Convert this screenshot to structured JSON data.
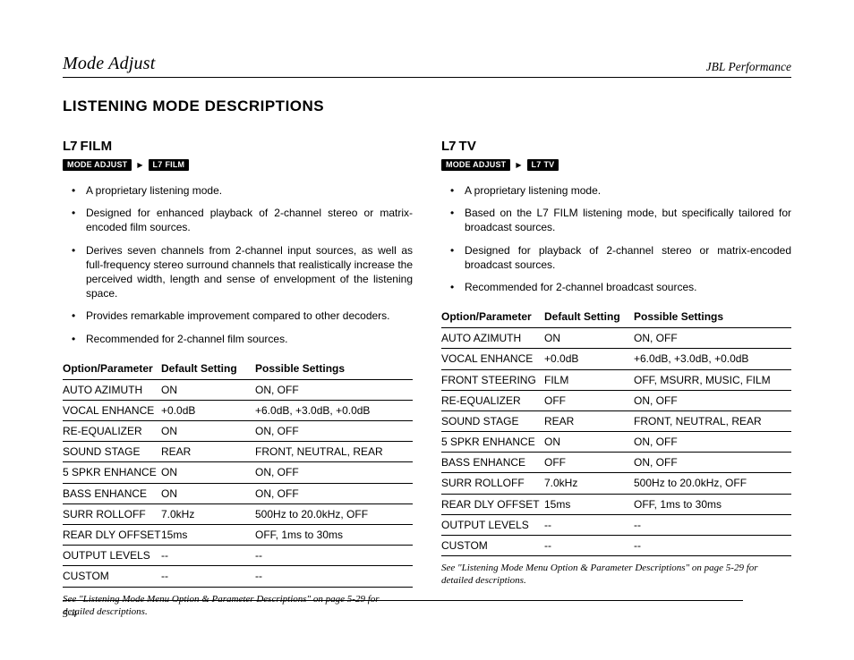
{
  "header": {
    "left": "Mode Adjust",
    "right": "JBL Performance"
  },
  "section_title": "LISTENING MODE DESCRIPTIONS",
  "page_number": "5-4",
  "caption": "See \"Listening Mode Menu Option & Parameter Descriptions\" on page 5-29 for detailed descriptions.",
  "table_headers": {
    "opt": "Option/Parameter",
    "def": "Default Setting",
    "pos": "Possible Settings"
  },
  "l7_prefix": "L7",
  "breadcrumb_mode_adjust": "MODE ADJUST",
  "left_mode": {
    "title": "FILM",
    "breadcrumb_target": "FILM",
    "bullets": [
      "A proprietary listening mode.",
      "Designed for enhanced playback of 2-channel stereo or matrix-encoded film sources.",
      "Derives seven channels from 2-channel input sources, as well as full-frequency stereo surround channels that realistically increase the perceived width, length and sense of envelopment of the listening space.",
      "Provides remarkable improvement compared to other decoders.",
      "Recommended for 2-channel film sources."
    ],
    "rows": [
      {
        "opt": "AUTO AZIMUTH",
        "def": "ON",
        "pos": "ON, OFF"
      },
      {
        "opt": "VOCAL ENHANCE",
        "def": "+0.0dB",
        "pos": "+6.0dB, +3.0dB, +0.0dB"
      },
      {
        "opt": "RE-EQUALIZER",
        "def": "ON",
        "pos": "ON, OFF"
      },
      {
        "opt": "SOUND STAGE",
        "def": "REAR",
        "pos": "FRONT, NEUTRAL, REAR"
      },
      {
        "opt": "5 SPKR ENHANCE",
        "def": "ON",
        "pos": "ON, OFF"
      },
      {
        "opt": "BASS ENHANCE",
        "def": "ON",
        "pos": "ON, OFF"
      },
      {
        "opt": "SURR ROLLOFF",
        "def": "7.0kHz",
        "pos": "500Hz to 20.0kHz, OFF"
      },
      {
        "opt": "REAR DLY OFFSET",
        "def": "15ms",
        "pos": "OFF, 1ms to 30ms"
      },
      {
        "opt": "OUTPUT LEVELS",
        "def": "--",
        "pos": "--"
      },
      {
        "opt": "CUSTOM",
        "def": "--",
        "pos": "--"
      }
    ]
  },
  "right_mode": {
    "title": "TV",
    "breadcrumb_target": "TV",
    "bullets": [
      "A proprietary listening mode.",
      "Based on the L7 FILM listening mode, but specifically tailored for broadcast sources.",
      "Designed for playback of 2-channel stereo or matrix-encoded broadcast sources.",
      "Recommended for 2-channel broadcast sources."
    ],
    "rows": [
      {
        "opt": "AUTO AZIMUTH",
        "def": "ON",
        "pos": "ON, OFF"
      },
      {
        "opt": "VOCAL ENHANCE",
        "def": "+0.0dB",
        "pos": "+6.0dB, +3.0dB, +0.0dB"
      },
      {
        "opt": "FRONT STEERING",
        "def": "FILM",
        "pos": "OFF, MSURR, MUSIC, FILM"
      },
      {
        "opt": "RE-EQUALIZER",
        "def": "OFF",
        "pos": "ON, OFF"
      },
      {
        "opt": "SOUND STAGE",
        "def": "REAR",
        "pos": "FRONT, NEUTRAL, REAR"
      },
      {
        "opt": "5 SPKR ENHANCE",
        "def": "ON",
        "pos": "ON, OFF"
      },
      {
        "opt": "BASS ENHANCE",
        "def": "OFF",
        "pos": "ON, OFF"
      },
      {
        "opt": "SURR ROLLOFF",
        "def": "7.0kHz",
        "pos": "500Hz to 20.0kHz, OFF"
      },
      {
        "opt": "REAR DLY OFFSET",
        "def": "15ms",
        "pos": "OFF, 1ms to 30ms"
      },
      {
        "opt": "OUTPUT LEVELS",
        "def": "--",
        "pos": "--"
      },
      {
        "opt": "CUSTOM",
        "def": "--",
        "pos": "--"
      }
    ]
  }
}
